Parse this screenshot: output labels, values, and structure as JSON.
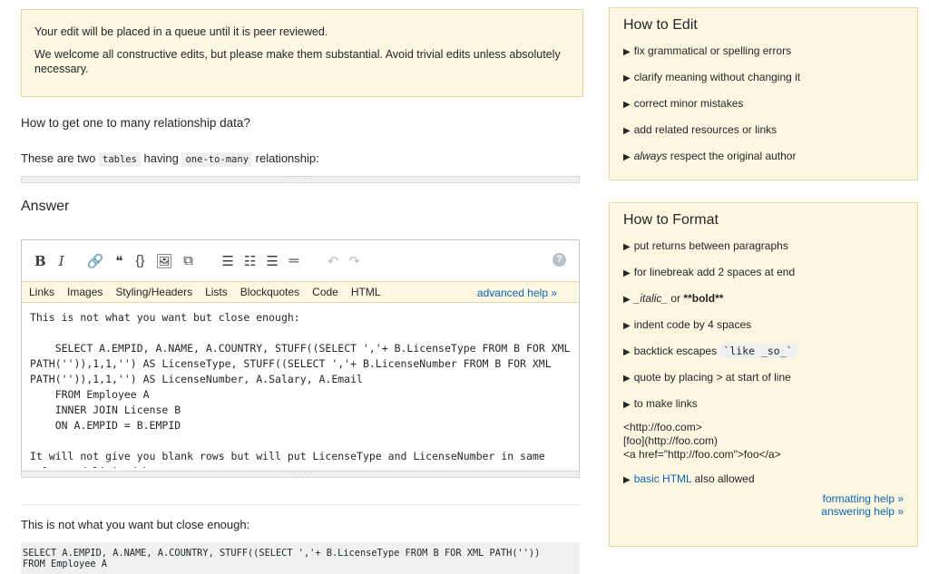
{
  "notice": {
    "line1": "Your edit will be placed in a queue until it is peer reviewed.",
    "line2": "We welcome all constructive edits, but please make them substantial. Avoid trivial edits unless absolutely necessary."
  },
  "question": {
    "title": "How to get one to many relationship data?",
    "line_before": "These are two ",
    "code1": "tables",
    "line_mid": " having ",
    "code2": "one-to-many",
    "line_after": " relationship:"
  },
  "answer_heading": "Answer",
  "toolbar": {
    "bold": "B",
    "italic": "I",
    "link": "🔗",
    "quote": "❝",
    "code": "{}",
    "image": "🖼",
    "snippet": "⧉",
    "olist": "☰",
    "ulist": "☷",
    "heading": "☰",
    "hr": "═",
    "undo": "↶",
    "redo": "↷",
    "help": "?"
  },
  "subtabs": [
    "Links",
    "Images",
    "Styling/Headers",
    "Lists",
    "Blockquotes",
    "Code",
    "HTML"
  ],
  "advanced_help": "advanced help »",
  "editor_text": "This is not what you want but close enough:\n\n    SELECT A.EMPID, A.NAME, A.COUNTRY, STUFF((SELECT ','+ B.LicenseType FROM B FOR XML PATH('')),1,1,'') AS LicenseType, STUFF((SELECT ','+ B.LicenseNumber FROM B FOR XML PATH('')),1,1,'') AS LicenseNumber, A.Salary, A.Email\n    FROM Employee A\n    INNER JOIN License B\n    ON A.EMPID = B.EMPID\n\nIt will not give you blank rows but will put LicenseType and LicenseNumber in same columns delimited by commas.",
  "preview": {
    "text": "This is not what you want but close enough:",
    "code": "SELECT A.EMPID, A.NAME, A.COUNTRY, STUFF((SELECT ','+ B.LicenseType FROM B FOR XML PATH(''))\nFROM Employee A"
  },
  "how_to_edit": {
    "title": "How to Edit",
    "items": [
      "fix grammatical or spelling errors",
      "clarify meaning without changing it",
      "correct minor mistakes",
      "add related resources or links"
    ],
    "last_em": "always",
    "last_rest": " respect the original author"
  },
  "how_to_format": {
    "title": "How to Format",
    "items": [
      "put returns between paragraphs",
      "for linebreak add 2 spaces at end"
    ],
    "italic_bold_a": "_italic_",
    "italic_bold_b": " or ",
    "italic_bold_c": "**bold**",
    "indent": "indent code by 4 spaces",
    "backtick_label": "backtick escapes ",
    "backtick_code": "`like _so_`",
    "quote": "quote by placing > at start of line",
    "links": "to make links",
    "link_ex1": "<http://foo.com>",
    "link_ex2": "[foo](http://foo.com)",
    "link_ex3": "<a href=\"http://foo.com\">foo</a>",
    "basic_html_link": "basic HTML",
    "basic_html_rest": " also allowed",
    "formatting_help": "formatting help »",
    "answering_help": "answering help »"
  }
}
